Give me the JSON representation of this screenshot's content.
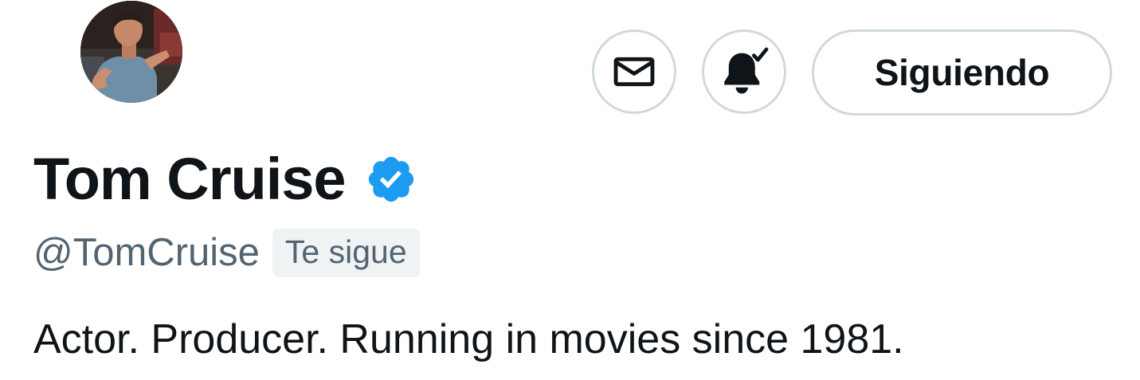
{
  "profile": {
    "display_name": "Tom Cruise",
    "handle": "@TomCruise",
    "follows_you_label": "Te sigue",
    "bio": "Actor. Producer. Running in movies since 1981.",
    "verified": true
  },
  "actions": {
    "message_icon": "envelope-icon",
    "notifications_icon": "bell-check-icon",
    "follow_label": "Siguiendo"
  },
  "colors": {
    "verified_badge": "#1d9bf0",
    "primary_text": "#0f1419",
    "secondary_text": "#536471",
    "button_border": "#cfd9de",
    "badge_bg": "#eff3f4"
  }
}
